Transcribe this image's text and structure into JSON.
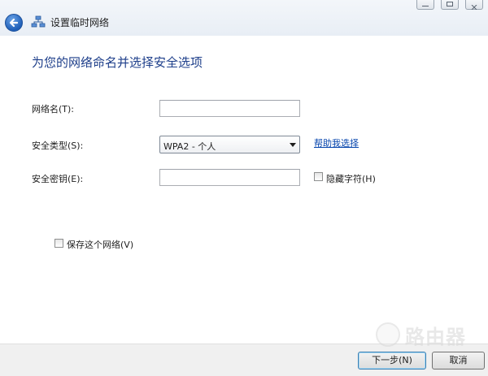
{
  "window": {
    "title": "设置临时网络"
  },
  "main": {
    "heading": "为您的网络命名并选择安全选项",
    "network_name": {
      "label": "网络名(T):",
      "value": ""
    },
    "security_type": {
      "label": "安全类型(S):",
      "selected": "WPA2 - 个人",
      "help_link": "帮助我选择"
    },
    "security_key": {
      "label": "安全密钥(E):",
      "value": ""
    },
    "hide_chars": {
      "label": "隐藏字符(H)",
      "checked": false
    },
    "save_network": {
      "label": "保存这个网络(V)",
      "checked": false
    }
  },
  "footer": {
    "next_label": "下一步(N)",
    "cancel_label": "取消"
  },
  "watermark": {
    "text": "路由器"
  },
  "colors": {
    "heading": "#1d3e8a",
    "link": "#0645ad",
    "footer_bg": "#f0f0f0"
  }
}
